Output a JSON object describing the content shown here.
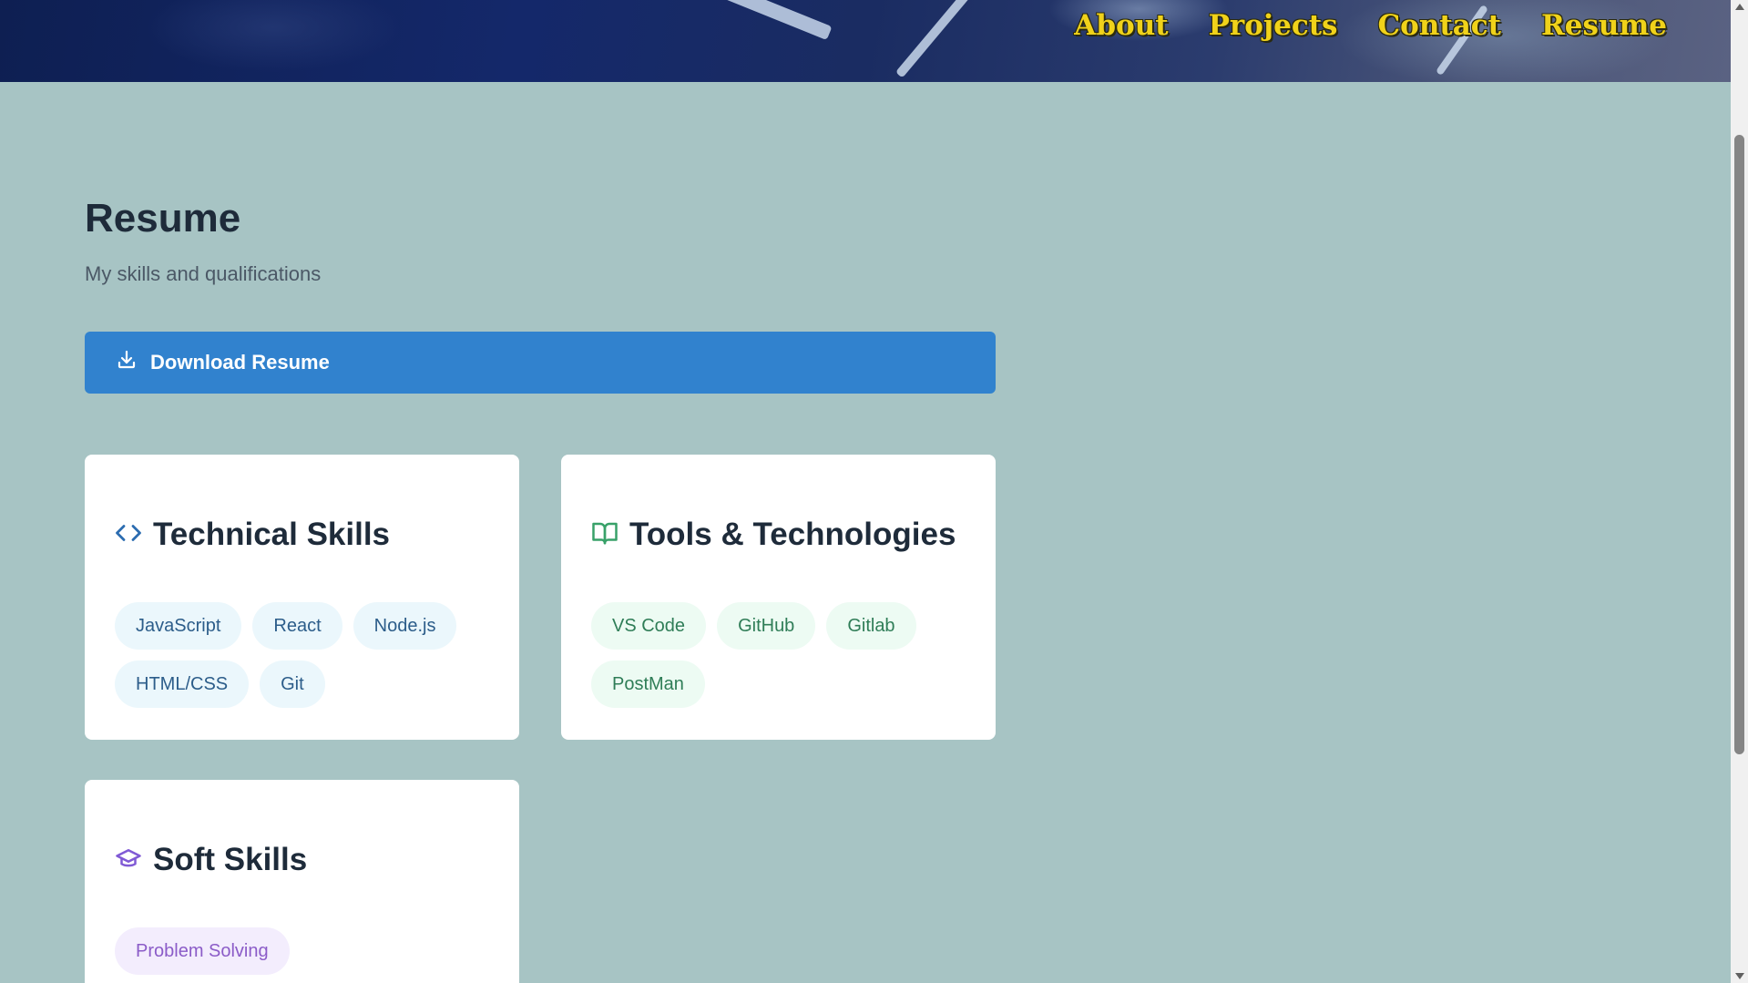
{
  "nav": [
    "About",
    "Projects",
    "Contact",
    "Resume"
  ],
  "page": {
    "title": "Resume",
    "subtitle": "My skills and qualifications",
    "download_label": "Download Resume"
  },
  "cards": {
    "technical": {
      "title": "Technical Skills",
      "icon": "code-icon",
      "tags": [
        "JavaScript",
        "React",
        "Node.js",
        "HTML/CSS",
        "Git"
      ]
    },
    "tools": {
      "title": "Tools & Technologies",
      "icon": "book-open-icon",
      "tags": [
        "VS Code",
        "GitHub",
        "Gitlab",
        "PostMan"
      ]
    },
    "soft": {
      "title": "Soft Skills",
      "icon": "graduation-cap-icon",
      "tags": [
        "Problem Solving"
      ]
    }
  },
  "colors": {
    "background": "#a7c4c4",
    "accent": "#3182ce",
    "nav_text": "#f0d21a"
  }
}
